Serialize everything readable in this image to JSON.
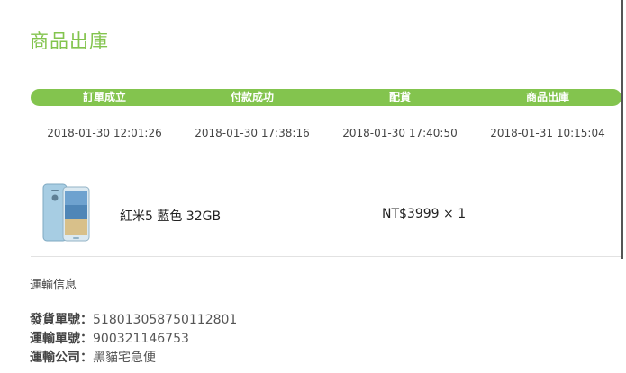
{
  "page": {
    "title": "商品出庫"
  },
  "progress": {
    "steps": [
      {
        "label": "訂單成立",
        "time": "2018-01-30 12:01:26"
      },
      {
        "label": "付款成功",
        "time": "2018-01-30 17:38:16"
      },
      {
        "label": "配貨",
        "time": "2018-01-30 17:40:50"
      },
      {
        "label": "商品出庫",
        "time": "2018-01-31 10:15:04"
      }
    ],
    "color": "#83c44e"
  },
  "product": {
    "image_icon": "phone-image",
    "name": "紅米5 藍色 32GB",
    "price": "NT$3999 × 1"
  },
  "shipping": {
    "heading": "運輸信息",
    "rows": [
      {
        "key": "發貨單號：",
        "value": "518013058750112801"
      },
      {
        "key": "運輸單號：",
        "value": "900321146753"
      },
      {
        "key": "運輸公司：",
        "value": "黑貓宅急便"
      }
    ]
  }
}
